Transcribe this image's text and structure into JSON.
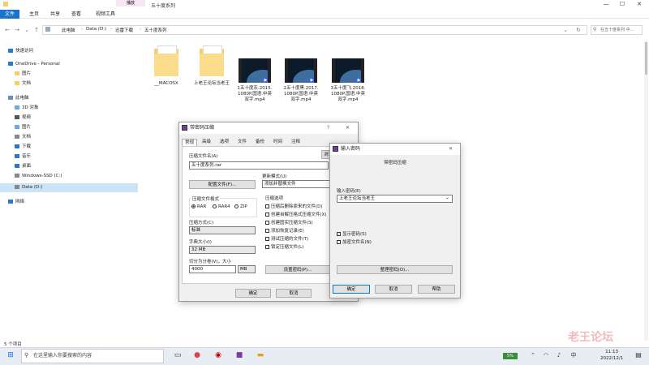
{
  "window": {
    "title": "五十度系列",
    "ribbon_context": "播放",
    "controls": [
      "—",
      "☐",
      "✕"
    ]
  },
  "ribbon": {
    "tabs": [
      "文件",
      "主页",
      "共享",
      "查看",
      "视频工具"
    ]
  },
  "address": {
    "breadcrumbs": [
      "此电脑",
      "Data (D:)",
      "迅雷下载",
      "五十度系列"
    ],
    "search_placeholder": "在五十度系列 中..."
  },
  "sidebar": {
    "items": [
      {
        "label": "快速访问",
        "icon": "star-icon",
        "indent": 0
      },
      {
        "label": "OneDrive - Personal",
        "icon": "cloud-icon",
        "indent": 0
      },
      {
        "label": "图片",
        "icon": "folder-icon",
        "indent": 1
      },
      {
        "label": "文档",
        "icon": "folder-icon",
        "indent": 1
      },
      {
        "label": "此电脑",
        "icon": "computer-icon",
        "indent": 0
      },
      {
        "label": "3D 对象",
        "icon": "cube-icon",
        "indent": 1
      },
      {
        "label": "视频",
        "icon": "video-icon",
        "indent": 1
      },
      {
        "label": "图片",
        "icon": "picture-icon",
        "indent": 1
      },
      {
        "label": "文档",
        "icon": "document-icon",
        "indent": 1
      },
      {
        "label": "下载",
        "icon": "download-icon",
        "indent": 1
      },
      {
        "label": "音乐",
        "icon": "music-icon",
        "indent": 1
      },
      {
        "label": "桌面",
        "icon": "desktop-icon",
        "indent": 1
      },
      {
        "label": "Windows-SSD (C:)",
        "icon": "drive-icon",
        "indent": 1
      },
      {
        "label": "Data (D:)",
        "icon": "drive-icon",
        "indent": 1,
        "selected": true
      },
      {
        "label": "网络",
        "icon": "network-icon",
        "indent": 0
      }
    ]
  },
  "files": [
    {
      "name": "__MACOSX",
      "type": "folder"
    },
    {
      "name": "上老王论坛当老王",
      "type": "folder"
    },
    {
      "name": "1五十度灰.2015.1080P.国语.中英双字.mp4",
      "type": "video"
    },
    {
      "name": "2五十度黑.2017.1080P.国语.中英双字.mp4",
      "type": "video"
    },
    {
      "name": "3五十度飞.2018.1080P.国语.中英双字.mp4",
      "type": "video"
    }
  ],
  "status": {
    "item_count": "5 个项目"
  },
  "archive_dialog": {
    "title": "带密码压缩",
    "help": "?",
    "close": "✕",
    "tabs": [
      "常规",
      "高级",
      "选项",
      "文件",
      "备份",
      "时间",
      "注释"
    ],
    "archive_name_label": "压缩文件名(A)",
    "browse_label": "浏",
    "archive_name_value": "五十度系列.rar",
    "profiles_button": "配置文件(F)...",
    "update_mode_label": "更新模式(U)",
    "update_mode_value": "添加并替换文件",
    "format_label": "压缩文件格式",
    "formats": [
      "RAR",
      "RAR4",
      "ZIP"
    ],
    "selected_format": "RAR",
    "method_label": "压缩方式(C)",
    "method_value": "标准",
    "dict_label": "字典大小(I)",
    "dict_value": "32 MB",
    "split_label": "切分为分卷(V)，大小",
    "split_value": "4000",
    "split_unit": "MB",
    "options_label": "压缩选项",
    "options": [
      "压缩后删除原来的文件(D)",
      "创建自解压格式压缩文件(X)",
      "创建固实压缩文件(S)",
      "添加恢复记录(E)",
      "测试压缩的文件(T)",
      "锁定压缩文件(L)"
    ],
    "set_password_button": "设置密码(P)...",
    "ok": "确定",
    "cancel": "取消"
  },
  "password_dialog": {
    "title": "输入密码",
    "close": "✕",
    "heading": "带密码压缩",
    "password_label": "输入密码(E)",
    "password_value": "上老王论坛当老王",
    "show_password": "显示密码(S)",
    "show_password_checked": true,
    "encrypt_names": "加密文件名(N)",
    "encrypt_names_checked": false,
    "organize_button": "整理密码(O)...",
    "ok": "确定",
    "cancel": "取消",
    "help": "帮助"
  },
  "taskbar": {
    "search_placeholder": "在这里输入你要搜索的内容",
    "time": "11:13",
    "date": "2022/12/1",
    "lang": "中",
    "tray_text": "5%"
  },
  "watermark": "老王论坛"
}
